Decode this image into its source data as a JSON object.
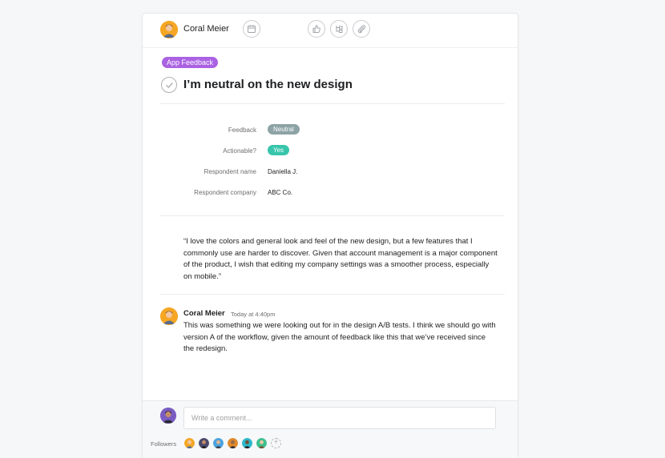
{
  "task": {
    "assignee": {
      "name": "Coral Meier"
    },
    "tag": "App Feedback",
    "title": "I’m neutral on the new design",
    "fields": [
      {
        "label": "Feedback",
        "value": "Neutral",
        "kind": "pill",
        "color": "#8da3a6"
      },
      {
        "label": "Actionable?",
        "value": "Yes",
        "kind": "pill",
        "color": "#37c5ab"
      },
      {
        "label": "Respondent name",
        "value": "Daniella J.",
        "kind": "text"
      },
      {
        "label": "Respondent company",
        "value": "ABC Co.",
        "kind": "text"
      }
    ],
    "description": "“I love the colors and general look and feel of the new design, but a few features that I commonly use are harder to discover. Given that account management is a major component of the product, I wish that editing my company settings was a smoother process, especially on mobile.”"
  },
  "toolbar": {
    "icons": [
      "calendar-icon",
      "thumbs-up-icon",
      "subtask-icon",
      "paperclip-icon"
    ]
  },
  "comment": {
    "author": "Coral Meier",
    "time": "Today at 4:40pm",
    "body": "This was something we were looking out for in the design A/B tests. I think we should go with version A of the workflow, given the amount of feedback like this that we’ve received since the redesign."
  },
  "composer": {
    "placeholder": "Write a comment...",
    "followers_label": "Followers",
    "followers": [
      {
        "avatar_color": "#f5a623"
      },
      {
        "avatar_color": "#4a4a6a"
      },
      {
        "avatar_color": "#4aa3df"
      },
      {
        "avatar_color": "#e0892b"
      },
      {
        "avatar_color": "#2bb7c9"
      },
      {
        "avatar_color": "#3fbf8f"
      }
    ],
    "add_follower": "+"
  },
  "colors": {
    "tag": "#aa62e3",
    "background": "#f6f7f9"
  }
}
